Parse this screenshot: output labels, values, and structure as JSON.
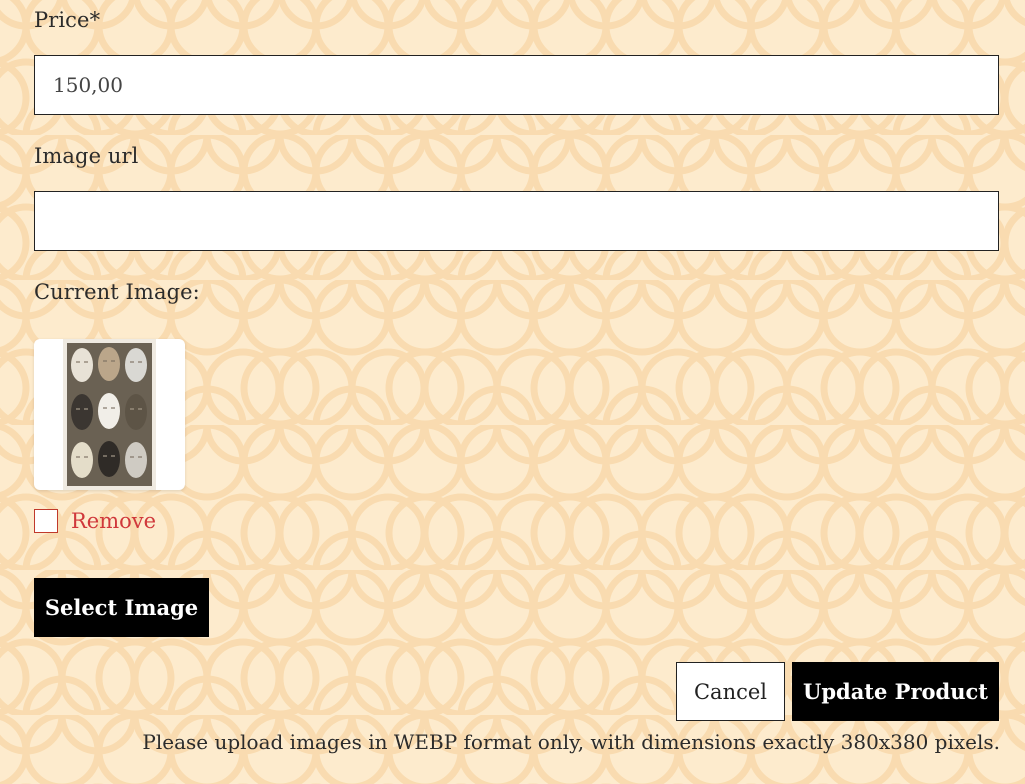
{
  "form": {
    "price": {
      "label": "Price*",
      "value": "150,00"
    },
    "image_url": {
      "label": "Image url",
      "value": "",
      "placeholder": ""
    },
    "current_image": {
      "label": "Current Image:",
      "thumbnail_icon": "ceramic-masks-photo"
    },
    "remove": {
      "label": "Remove",
      "checked": false
    },
    "select_image_button": "Select Image",
    "cancel_button": "Cancel",
    "update_button": "Update Product",
    "note": "Please upload images in WEBP format only, with dimensions exactly 380x380 pixels."
  },
  "colors": {
    "background": "#fdebcd",
    "pattern": "#f8dcb0",
    "button_dark": "#000000",
    "remove_red": "#d0383b"
  }
}
